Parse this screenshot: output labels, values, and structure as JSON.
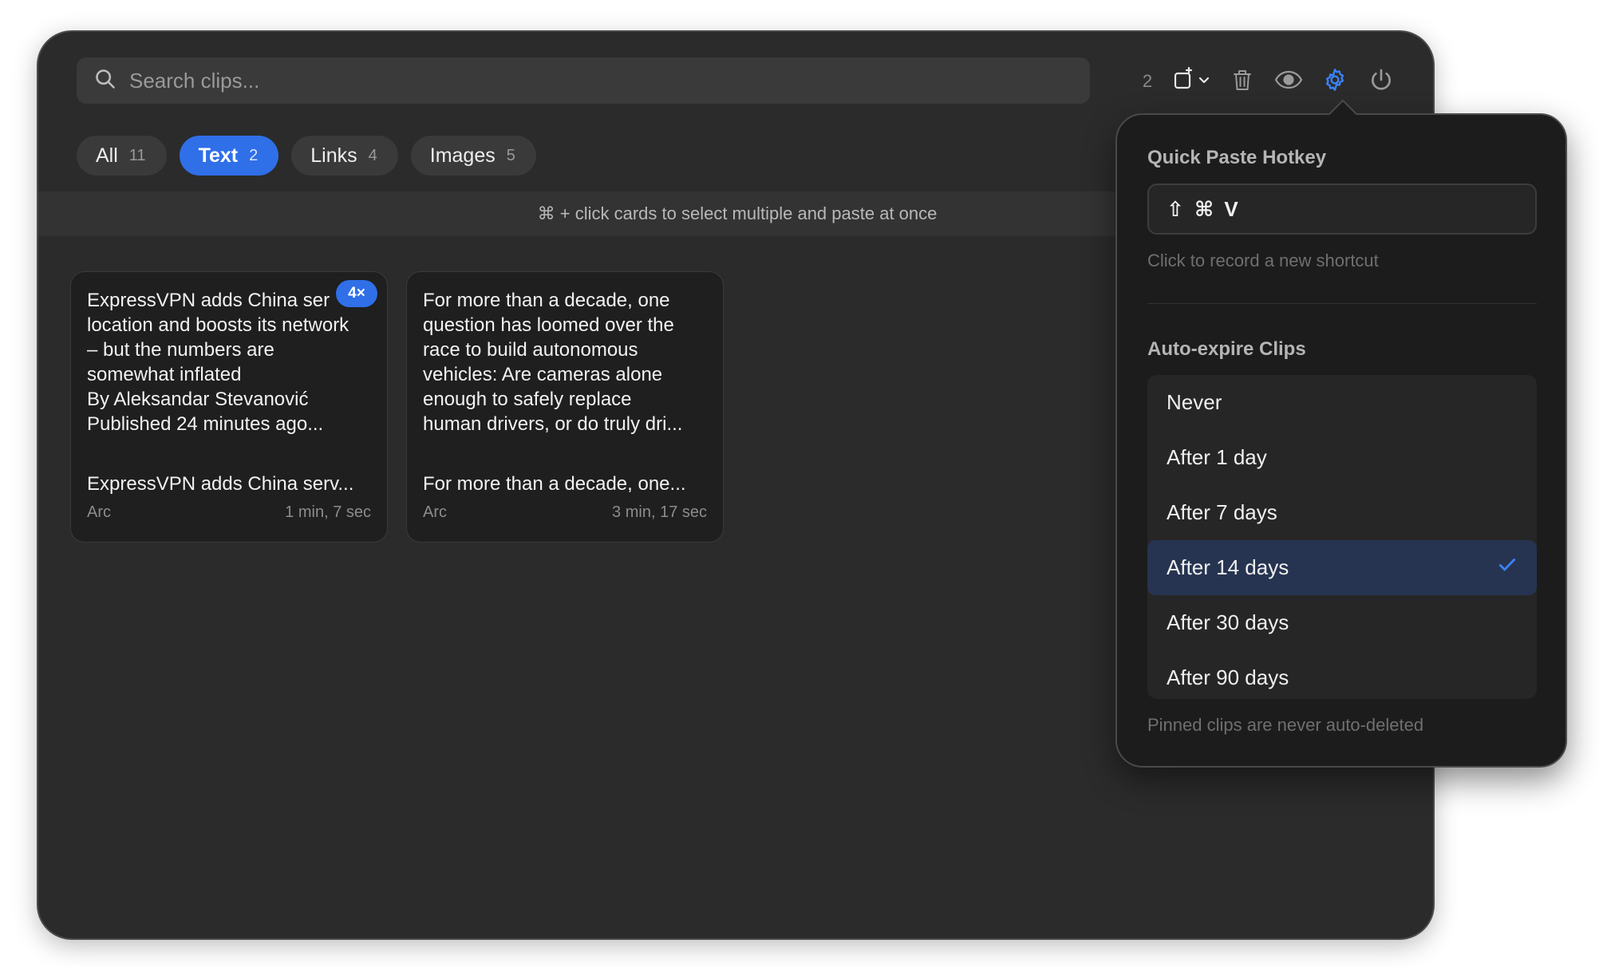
{
  "search": {
    "placeholder": "Search clips..."
  },
  "toolbar": {
    "selected_count": "2",
    "icons": [
      "paste-target-icon",
      "chevron-down-icon",
      "trash-icon",
      "eye-icon",
      "gear-icon",
      "power-icon"
    ],
    "accent": "#2f6fe8"
  },
  "tabs": [
    {
      "label": "All",
      "count": "11",
      "active": false
    },
    {
      "label": "Text",
      "count": "2",
      "active": true
    },
    {
      "label": "Links",
      "count": "4",
      "active": false
    },
    {
      "label": "Images",
      "count": "5",
      "active": false
    }
  ],
  "hint": "⌘ + click cards to select multiple and paste at once",
  "cards": [
    {
      "body": "ExpressVPN adds China ser\nlocation and boosts its network\n– but the numbers are\nsomewhat inflated\nBy Aleksandar Stevanović\nPublished 24 minutes ago...",
      "badge": "4×",
      "title": "ExpressVPN adds China serv...",
      "source": "Arc",
      "time": "1 min, 7 sec"
    },
    {
      "body": "For more than a decade, one\nquestion has loomed over the\nrace to build autonomous\nvehicles: Are cameras alone\nenough to safely replace\nhuman drivers, or do truly dri...",
      "title": "For more than a decade, one...",
      "source": "Arc",
      "time": "3 min, 17 sec"
    }
  ],
  "settings": {
    "hotkey_title": "Quick Paste Hotkey",
    "hotkey_value": "⇧ ⌘ V",
    "hotkey_hint": "Click to record a new shortcut",
    "expire_title": "Auto-expire Clips",
    "expire_options": [
      "Never",
      "After 1 day",
      "After 7 days",
      "After 14 days",
      "After 30 days",
      "After 90 days"
    ],
    "expire_selected": "After 14 days",
    "expire_note": "Pinned clips are never auto-deleted"
  }
}
